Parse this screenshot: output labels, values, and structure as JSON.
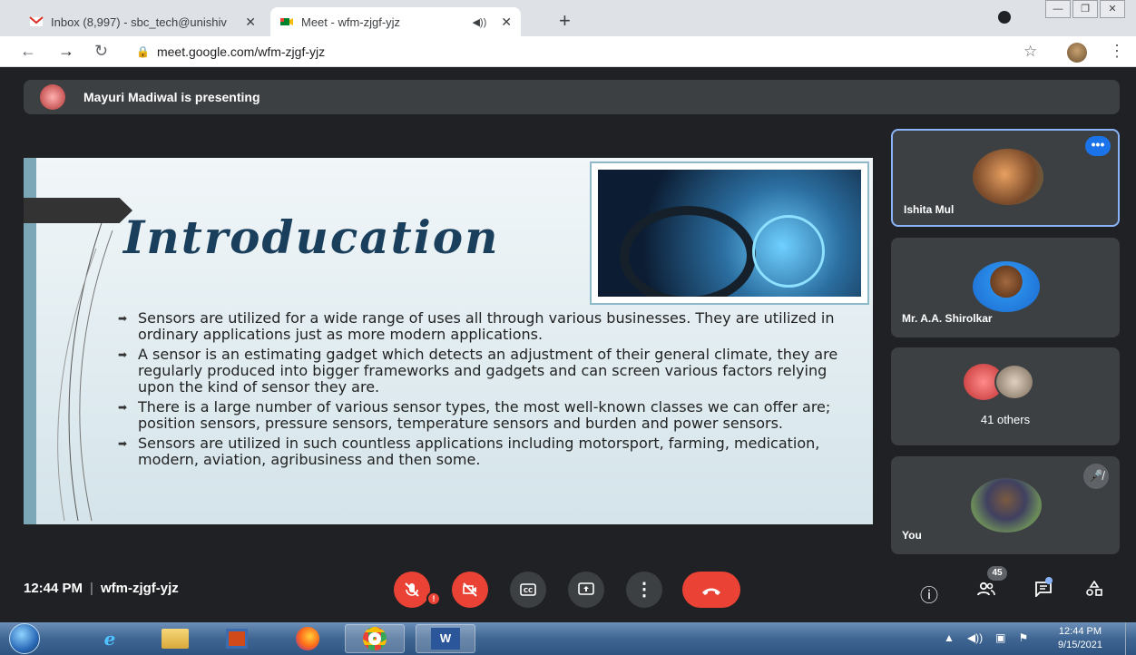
{
  "browser": {
    "tabs": [
      {
        "label": "Inbox (8,997) - sbc_tech@unishiv",
        "icon": "gmail-icon"
      },
      {
        "label": "Meet - wfm-zjgf-yjz",
        "icon": "meet-icon"
      }
    ],
    "url": "meet.google.com/wfm-zjgf-yjz"
  },
  "meet": {
    "presenting_text": "Mayuri Madiwal is presenting",
    "slide": {
      "title": "Introducation",
      "bullets": [
        "Sensors are utilized for a wide range of uses all through various businesses. They are utilized in ordinary applications just as more modern applications.",
        "A sensor is an estimating gadget which detects an adjustment of their general climate, they are regularly produced into bigger frameworks and gadgets and can screen various factors relying upon the kind of sensor they are.",
        "There is a large number of various sensor types, the most well-known classes we can offer are; position sensors, pressure sensors, temperature sensors and burden and power sensors.",
        "Sensors are utilized in such countless applications including motorsport, farming, medication, modern, aviation, agribusiness and then some."
      ]
    },
    "tiles": {
      "ishita": "Ishita Mul",
      "shirolkar": "Mr. A.A. Shirolkar",
      "others": "41 others",
      "you": "You"
    },
    "time": "12:44 PM",
    "separator": "|",
    "meeting_code": "wfm-zjgf-yjz",
    "participant_count": "45"
  },
  "taskbar": {
    "time": "12:44 PM",
    "date": "9/15/2021"
  }
}
